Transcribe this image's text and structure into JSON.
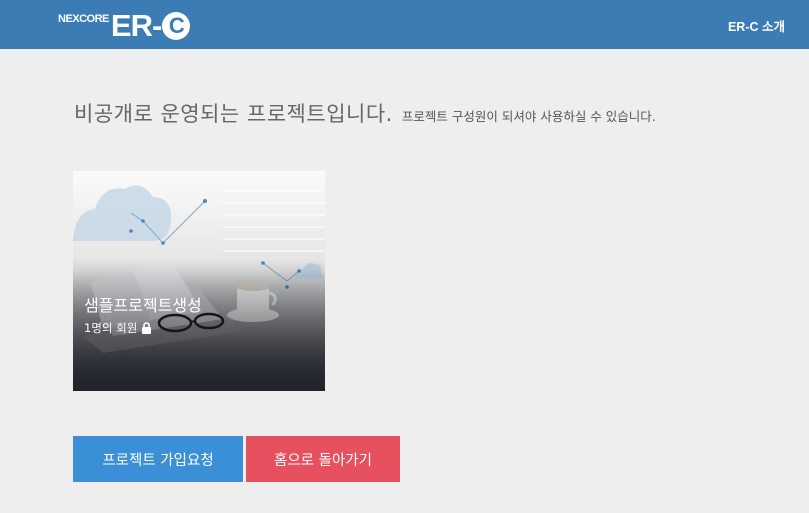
{
  "header": {
    "logo_prefix": "NEXCORE",
    "logo_main": "ER-",
    "logo_circle": "C",
    "about_link": "ER-C 소개"
  },
  "notice": {
    "main": "비공개로 운영되는 프로젝트입니다.",
    "sub": "프로젝트 구성원이 되셔야 사용하실 수 있습니다."
  },
  "project_card": {
    "title": "샘플프로젝트생성",
    "members": "1명의 회원",
    "lock_icon": "lock-icon"
  },
  "actions": {
    "join_label": "프로젝트 가입요청",
    "home_label": "홈으로 돌아가기"
  },
  "colors": {
    "header_bg": "#3a7cb3",
    "join_button": "#3b8fd6",
    "home_button": "#e6505f",
    "page_bg": "#eeeeee"
  }
}
